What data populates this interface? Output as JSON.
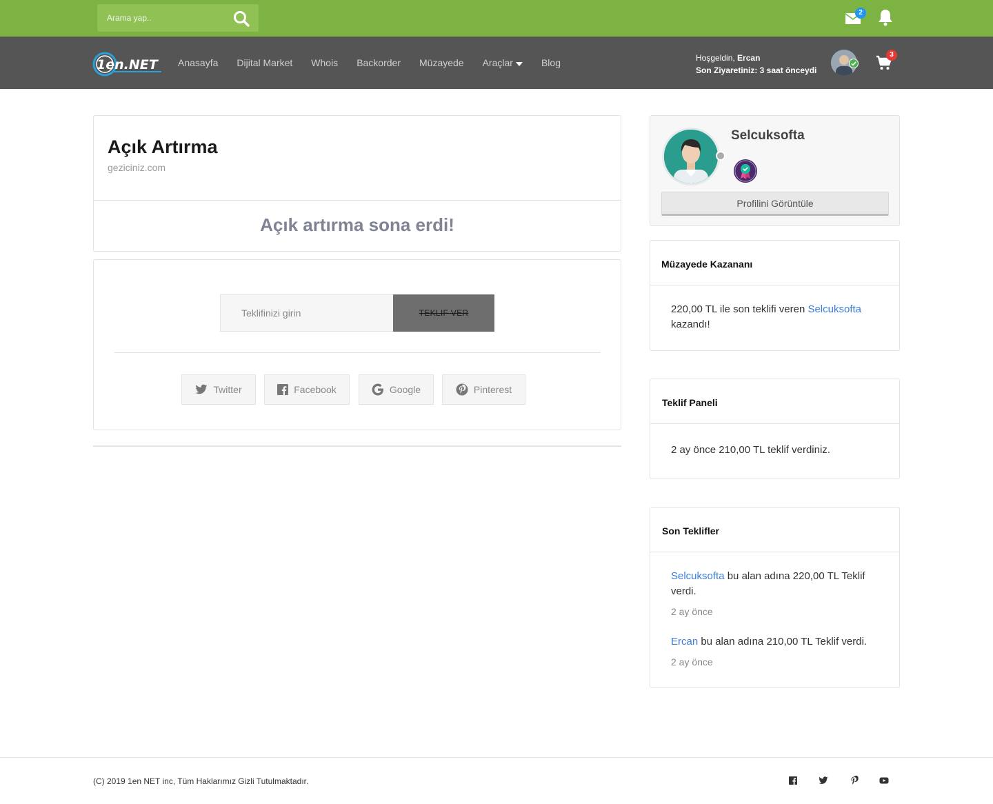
{
  "search": {
    "placeholder": "Arama yap.."
  },
  "topbar": {
    "mail_badge": "2",
    "cart_badge": "3"
  },
  "nav": {
    "logo_text": "1en.NET",
    "items": [
      {
        "label": "Anasayfa"
      },
      {
        "label": "Dijital Market"
      },
      {
        "label": "Whois"
      },
      {
        "label": "Backorder"
      },
      {
        "label": "Müzayede"
      },
      {
        "label": "Araçlar"
      },
      {
        "label": "Blog"
      }
    ]
  },
  "user": {
    "greeting": "Hoşgeldin,",
    "name": "Ercan",
    "last_visit": "Son Ziyaretiniz: 3 saat önceydi"
  },
  "auction": {
    "title": "Açık Artırma",
    "domain": "geziciniz.com",
    "ended_message": "Açık artırma sona erdi!",
    "bid_placeholder": "Teklifinizi girin",
    "bid_button": "TEKLIF VER"
  },
  "share": {
    "twitter": "Twitter",
    "facebook": "Facebook",
    "google": "Google",
    "pinterest": "Pinterest"
  },
  "seller": {
    "name": "Selcuksofta",
    "profile_button": "Profilini Görüntüle"
  },
  "winner_panel": {
    "title": "Müzayede Kazananı",
    "text_before": "220,00 TL ile son teklifi veren ",
    "winner": "Selcuksofta",
    "text_after": "kazandı!"
  },
  "bid_panel": {
    "title": "Teklif Paneli",
    "text": "2 ay önce 210,00 TL teklif verdiniz."
  },
  "recent_bids": {
    "title": "Son Teklifler",
    "items": [
      {
        "user": "Selcuksofta",
        "text": " bu alan adına 220,00 TL Teklif verdi.",
        "time": "2 ay önce"
      },
      {
        "user": "Ercan",
        "text": " bu alan adına 210,00 TL Teklif verdi.",
        "time": "2 ay önce"
      }
    ]
  },
  "footer": {
    "copyright": "(C) 2019 1en NET inc, Tüm Haklarımız Gizli Tutulmaktadır."
  },
  "colors": {
    "topbar": "#7cb342",
    "navbar": "#555555",
    "link": "#3b7dd8",
    "badge_blue": "#2196f3",
    "badge_red": "#e53935"
  }
}
